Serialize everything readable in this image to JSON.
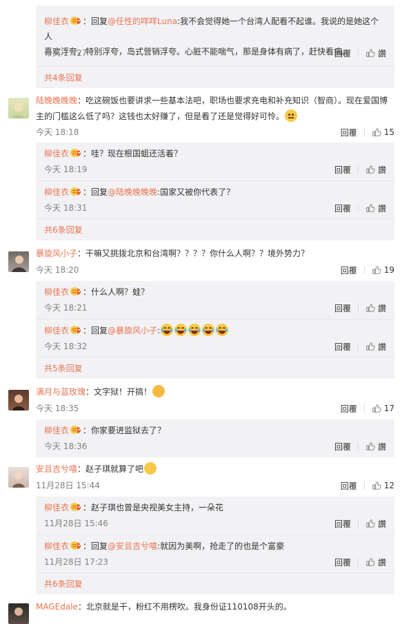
{
  "actions": {
    "reply_label": "回覆",
    "like_label": "讚"
  },
  "colors": {
    "link": "#eb7350",
    "reply_bg": "#f2f2f5"
  },
  "thread0": {
    "reply": {
      "user": "柳佳衣",
      "prefix": "：回复",
      "mention": "@任性的咩咩Luna",
      "text1": ":我不会觉得她一个台湾人配看不起谁。我说的是她这个人",
      "text2": "喜欢浮夸，特别浮夸，岛式营销浮夸。心脏不能喘气，那是身体有病了，赶快看病。",
      "time": "今天 17:27"
    },
    "total": "共4条回复"
  },
  "comments": [
    {
      "user": "陆晚晚晚晚",
      "line1": "：吃这碗饭也要讲求一些基本法吧，职场也要求充电和补充知识（智商）。现在爱国博",
      "line2": "主的门槛这么低了吗？这钱也太好赚了，但是看了还是觉得好可怜。",
      "time": "今天 18:18",
      "likes": "15",
      "replies": [
        {
          "user": "柳佳衣",
          "text": "：哇？现在根国蛆还活着？",
          "time": "今天 18:19"
        },
        {
          "user": "柳佳衣",
          "prefix": "：回复",
          "mention": "@陆晚晚晚晚",
          "text": ":国家又被你代表了？",
          "time": "今天 18:31"
        }
      ],
      "total": "共6条回复"
    },
    {
      "user": "暴旋风小子",
      "line1": "：干嘛又挑拨北京和台湾啊？？？？你什么人啊？？境外势力？",
      "time": "今天 18:20",
      "likes": "19",
      "replies": [
        {
          "user": "柳佳衣",
          "text": "：什么人啊？蛙？",
          "time": "今天 18:21"
        },
        {
          "user": "柳佳衣",
          "prefix": "：回复",
          "mention": "@暴旋风小子",
          "text": ":",
          "time": "今天 18:32"
        }
      ],
      "total": "共5条回复"
    },
    {
      "user": "满月与蓝玫瑰",
      "line1": "：文字狱！开搞！",
      "time": "今天 18:35",
      "likes": "17",
      "replies": [
        {
          "user": "柳佳衣",
          "text": "：你家要进监狱去了？",
          "time": "今天 18:36"
        }
      ]
    },
    {
      "user": "安且吉兮嘻",
      "line1": "：赵子琪就算了吧",
      "time": "11月28日 15:44",
      "likes": "12",
      "replies": [
        {
          "user": "柳佳衣",
          "text": "：赵子琪也曾是央视美女主持，一朵花",
          "time": "11月28日 15:46"
        },
        {
          "user": "柳佳衣",
          "prefix": "：回复",
          "mention": "@安且吉兮嘻",
          "text": ":就因为美啊，抢走了的也是个富豪",
          "time": "11月28日 17:23"
        }
      ],
      "total": "共6条回复"
    },
    {
      "user": "MAGEdale",
      "line1": "：北京就是干，粉红不用楞吹。我身份证110108开头的。"
    }
  ]
}
